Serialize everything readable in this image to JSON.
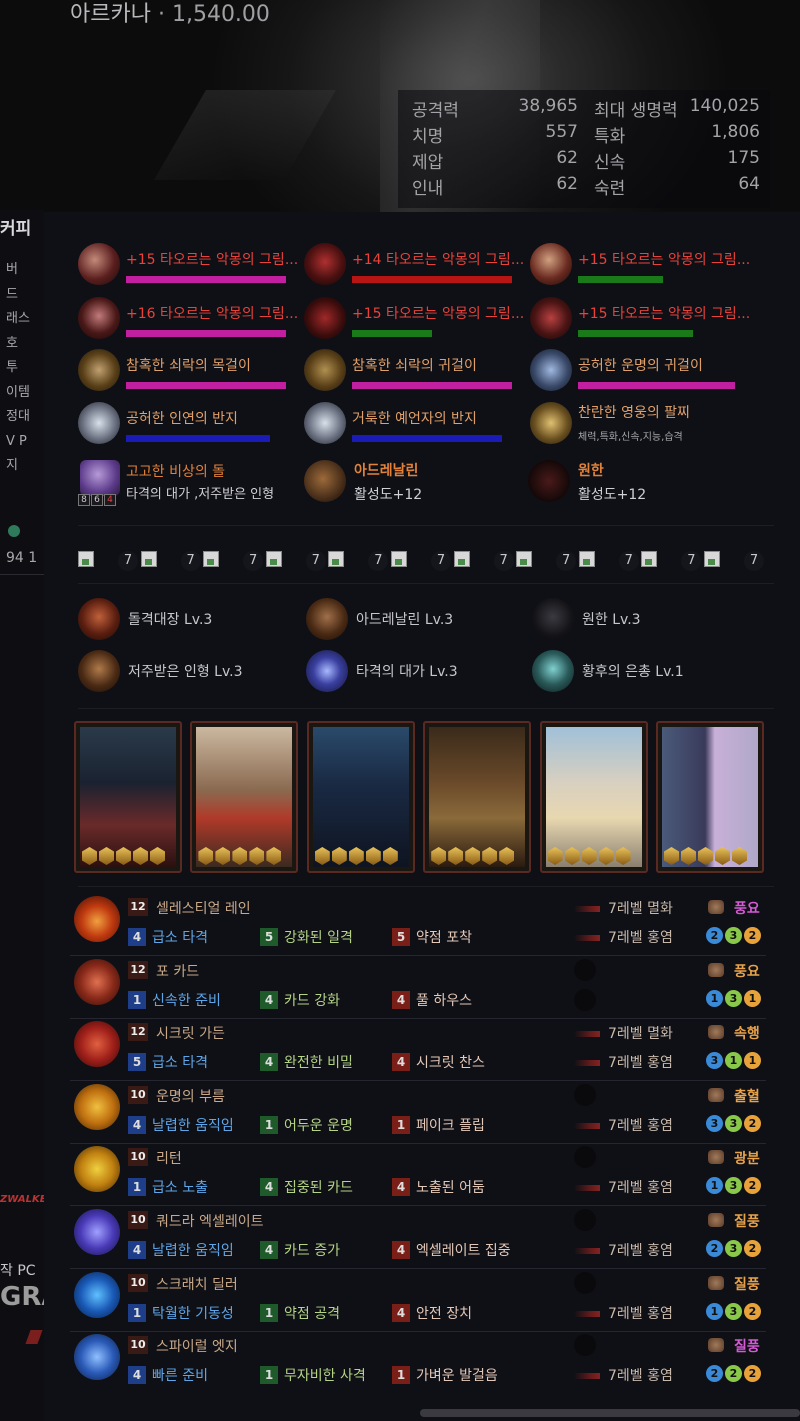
{
  "character": {
    "class": "아르카나",
    "item_level": "· 1,540.00"
  },
  "stats": [
    {
      "name": "공격력",
      "value": "38,965"
    },
    {
      "name": "최대 생명력",
      "value": "140,025"
    },
    {
      "name": "치명",
      "value": "557"
    },
    {
      "name": "특화",
      "value": "1,806"
    },
    {
      "name": "제압",
      "value": "62"
    },
    {
      "name": "신속",
      "value": "175"
    },
    {
      "name": "인내",
      "value": "62"
    },
    {
      "name": "숙련",
      "value": "64"
    }
  ],
  "sidebar": {
    "title": "커피",
    "items": [
      "버",
      "드",
      "래스",
      "호",
      "투",
      "이템",
      "정대",
      "V P",
      "지"
    ],
    "count": "94 1",
    "ad_brand": "ZWALKER",
    "ad_line": "작 PC",
    "ad_big": "GRA"
  },
  "equipment": [
    {
      "name": "+15 타오르는 악몽의 그림...",
      "bar": "#c21ea0",
      "bar_fill": 1.0
    },
    {
      "name": "+14 타오르는 악몽의 그림...",
      "bar": "#b71414",
      "bar_fill": 1.0
    },
    {
      "name": "+15 타오르는 악몽의 그림...",
      "bar": "#1a7a1a",
      "bar_fill": 0.53
    },
    {
      "name": "+16 타오르는 악몽의 그림...",
      "bar": "#c21ea0",
      "bar_fill": 1.0
    },
    {
      "name": "+15 타오르는 악몽의 그림...",
      "bar": "#1a7a1a",
      "bar_fill": 0.5
    },
    {
      "name": "+15 타오르는 악몽의 그림...",
      "bar": "#1a7a1a",
      "bar_fill": 0.72
    },
    {
      "name": "참혹한 쇠락의 목걸이",
      "bar": "#c21ea0",
      "bar_fill": 1.0
    },
    {
      "name": "참혹한 쇠락의 귀걸이",
      "bar": "#c21ea0",
      "bar_fill": 1.0
    },
    {
      "name": "공허한 운명의 귀걸이",
      "bar": "#c21ea0",
      "bar_fill": 0.98
    },
    {
      "name": "공허한 인연의 반지",
      "bar": "#1b1bb8",
      "bar_fill": 0.9
    },
    {
      "name": "거룩한 예언자의 반지",
      "bar": "#1b1bb8",
      "bar_fill": 0.94
    },
    {
      "name": "찬란한 영웅의 팔찌",
      "sub": "체력,특화,신속,지능,습격"
    }
  ],
  "stone": {
    "name": "고고한 비상의 돌",
    "desc": "타격의 대가 ,저주받은 인형",
    "counts": [
      "8",
      "6",
      "4"
    ]
  },
  "extras": [
    {
      "name": "아드레날린",
      "desc": "활성도+12"
    },
    {
      "name": "원한",
      "desc": "활성도+12"
    }
  ],
  "jewels": [
    "7",
    "7",
    "7",
    "7",
    "7",
    "7",
    "7",
    "7",
    "7",
    "7",
    "7"
  ],
  "engravings": [
    {
      "name": "돌격대장 Lv.3"
    },
    {
      "name": "아드레날린 Lv.3"
    },
    {
      "name": "원한 Lv.3"
    },
    {
      "name": "저주받은 인형 Lv.3"
    },
    {
      "name": "타격의 대가 Lv.3"
    },
    {
      "name": "황후의 은총 Lv.1"
    }
  ],
  "cards": [
    {
      "awakened": 5
    },
    {
      "awakened": 5
    },
    {
      "awakened": 5
    },
    {
      "awakened": 5
    },
    {
      "awakened": 5
    },
    {
      "awakened": 5
    }
  ],
  "skills": [
    {
      "lv": "12",
      "name": "셀레스티얼 레인",
      "t1": [
        "4",
        "급소 타격"
      ],
      "t2": [
        "5",
        "강화된 일격"
      ],
      "t3": [
        "5",
        "약점 포착"
      ],
      "rune1": "7레벨 멸화",
      "rune2": "7레벨 홍염",
      "gem": "풍요",
      "gem_color": "#d65ad6",
      "circles": [
        "2",
        "3",
        "2"
      ]
    },
    {
      "lv": "12",
      "name": "포 카드",
      "t1": [
        "1",
        "신속한 준비"
      ],
      "t2": [
        "4",
        "카드 강화"
      ],
      "t3": [
        "4",
        "풀 하우스"
      ],
      "rune1": "",
      "rune2": "",
      "gem": "풍요",
      "gem_color": "#e8a24a",
      "circles": [
        "1",
        "3",
        "1"
      ]
    },
    {
      "lv": "12",
      "name": "시크릿 가든",
      "t1": [
        "5",
        "급소 타격"
      ],
      "t2": [
        "4",
        "완전한 비밀"
      ],
      "t3": [
        "4",
        "시크릿 찬스"
      ],
      "rune1": "7레벨 멸화",
      "rune2": "7레벨 홍염",
      "gem": "속행",
      "gem_color": "#e8a24a",
      "circles": [
        "3",
        "1",
        "1"
      ]
    },
    {
      "lv": "10",
      "name": "운명의 부름",
      "t1": [
        "4",
        "날렵한 움직임"
      ],
      "t2": [
        "1",
        "어두운 운명"
      ],
      "t3": [
        "1",
        "페이크 플립"
      ],
      "rune1": "",
      "rune2": "7레벨 홍염",
      "gem": "출혈",
      "gem_color": "#e8a24a",
      "circles": [
        "3",
        "3",
        "2"
      ]
    },
    {
      "lv": "10",
      "name": "리턴",
      "t1": [
        "1",
        "급소 노출"
      ],
      "t2": [
        "4",
        "집중된 카드"
      ],
      "t3": [
        "4",
        "노출된 어둠"
      ],
      "rune1": "",
      "rune2": "7레벨 홍염",
      "gem": "광분",
      "gem_color": "#e8a24a",
      "circles": [
        "1",
        "3",
        "2"
      ]
    },
    {
      "lv": "10",
      "name": "쿼드라 엑셀레이트",
      "t1": [
        "4",
        "날렵한 움직임"
      ],
      "t2": [
        "4",
        "카드 증가"
      ],
      "t3": [
        "4",
        "엑셀레이트 집중"
      ],
      "rune1": "",
      "rune2": "7레벨 홍염",
      "gem": "질풍",
      "gem_color": "#e8a24a",
      "circles": [
        "2",
        "3",
        "2"
      ]
    },
    {
      "lv": "10",
      "name": "스크래치 딜러",
      "t1": [
        "1",
        "탁월한 기동성"
      ],
      "t2": [
        "1",
        "약점 공격"
      ],
      "t3": [
        "4",
        "안전 장치"
      ],
      "rune1": "",
      "rune2": "7레벨 홍염",
      "gem": "질풍",
      "gem_color": "#e8a24a",
      "circles": [
        "1",
        "3",
        "2"
      ]
    },
    {
      "lv": "10",
      "name": "스파이럴 엣지",
      "t1": [
        "4",
        "빠른 준비"
      ],
      "t2": [
        "1",
        "무자비한 사격"
      ],
      "t3": [
        "1",
        "가벼운 발걸음"
      ],
      "rune1": "",
      "rune2": "7레벨 홍염",
      "gem": "질풍",
      "gem_color": "#d65ad6",
      "circles": [
        "2",
        "2",
        "2"
      ]
    }
  ]
}
